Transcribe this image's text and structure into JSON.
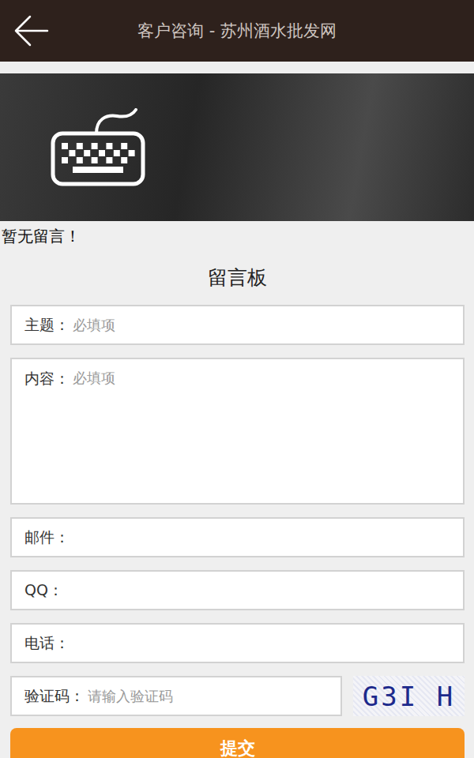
{
  "header": {
    "title": "客户咨询 - 苏州酒水批发网"
  },
  "messages": {
    "empty_text": "暂无留言！"
  },
  "form": {
    "title": "留言板",
    "fields": [
      {
        "label": "主题：",
        "placeholder": "必填项",
        "kind": "input"
      },
      {
        "label": "内容：",
        "placeholder": "必填项",
        "kind": "textarea"
      },
      {
        "label": "邮件：",
        "placeholder": "",
        "kind": "input"
      },
      {
        "label": "QQ：",
        "placeholder": "",
        "kind": "input"
      },
      {
        "label": "电话：",
        "placeholder": "",
        "kind": "input"
      }
    ],
    "captcha": {
      "label": "验证码：",
      "placeholder": "请输入验证码",
      "code": "G3I H"
    },
    "submit": "提交"
  }
}
